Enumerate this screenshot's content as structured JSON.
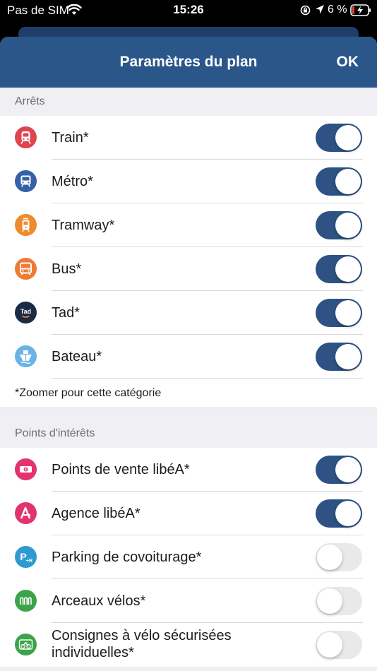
{
  "status_bar": {
    "carrier": "Pas de SIM",
    "time": "15:26",
    "battery_percent": "6 %"
  },
  "nav": {
    "title": "Paramètres du plan",
    "ok_label": "OK"
  },
  "sections": {
    "stops": {
      "header": "Arrêts",
      "items": [
        {
          "label": "Train*",
          "enabled": true,
          "icon": "train-icon",
          "color": "#e0444f"
        },
        {
          "label": "Métro*",
          "enabled": true,
          "icon": "metro-icon",
          "color": "#3561a8"
        },
        {
          "label": "Tramway*",
          "enabled": true,
          "icon": "tramway-icon",
          "color": "#ef8a2f"
        },
        {
          "label": "Bus*",
          "enabled": true,
          "icon": "bus-icon",
          "color": "#ef7a34"
        },
        {
          "label": "Tad*",
          "enabled": true,
          "icon": "tad-icon",
          "color": "#1c2a44"
        },
        {
          "label": "Bateau*",
          "enabled": true,
          "icon": "boat-icon",
          "color": "#6ab3e6"
        }
      ],
      "note": "*Zoomer pour cette catégorie"
    },
    "poi": {
      "header": "Points d'intérêts",
      "items": [
        {
          "label": "Points de vente libéA*",
          "enabled": true,
          "icon": "ticket-sales-icon",
          "color": "#e2336f"
        },
        {
          "label": "Agence libéA*",
          "enabled": true,
          "icon": "agency-icon",
          "color": "#e2336f"
        },
        {
          "label": "Parking de covoiturage*",
          "enabled": false,
          "icon": "carpool-parking-icon",
          "color": "#2f9ad0"
        },
        {
          "label": "Arceaux vélos*",
          "enabled": false,
          "icon": "bike-rack-icon",
          "color": "#3da34a"
        },
        {
          "label": "Consignes à vélo sécurisées individuelles*",
          "enabled": false,
          "icon": "bike-locker-icon",
          "color": "#3da34a"
        }
      ]
    }
  },
  "colors": {
    "nav_bg": "#2b5689",
    "toggle_on": "#2d5283",
    "toggle_off": "#e9e9ea",
    "page_bg": "#efeff4"
  }
}
